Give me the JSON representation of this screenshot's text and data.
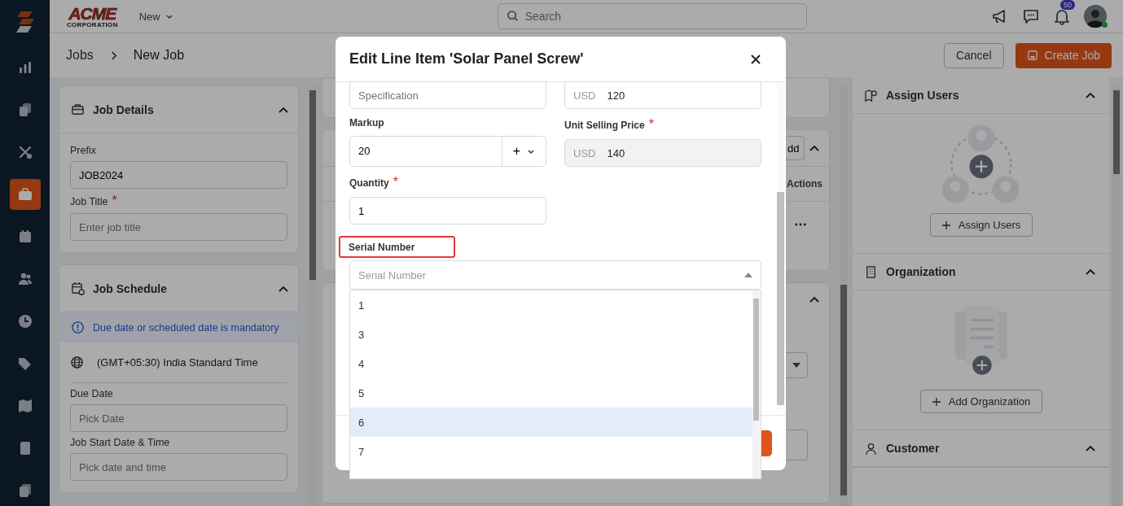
{
  "sidebar": {
    "items": [
      {
        "selected": false
      },
      {
        "selected": false
      },
      {
        "selected": false
      },
      {
        "selected": true
      },
      {
        "selected": false
      },
      {
        "selected": false
      },
      {
        "selected": false
      },
      {
        "selected": false
      },
      {
        "selected": false
      },
      {
        "selected": false
      },
      {
        "selected": false
      }
    ]
  },
  "topbar": {
    "brand": "ACME",
    "brand_sub": "CORPORATION",
    "new_menu": "New",
    "search": {
      "placeholder": "Search"
    },
    "notifications": "50",
    "user_online": true
  },
  "header": {
    "breadcrumb": [
      "Jobs",
      "New Job"
    ],
    "cancel": "Cancel",
    "create": "Create Job"
  },
  "job_details": {
    "title": "Job Details",
    "expanded": true,
    "fields": [
      {
        "label": "Prefix",
        "value": "JOB2024"
      },
      {
        "label": "Job Title",
        "required_mark": "*",
        "placeholder": "Enter job title"
      }
    ]
  },
  "job_schedule": {
    "title": "Job Schedule",
    "expanded": true,
    "notice": "Due date or scheduled date is mandatory",
    "timezone": "(GMT+05:30) India Standard Time",
    "fields": [
      {
        "label": "Due Date",
        "placeholder": "Pick Date"
      },
      {
        "label": "Job Start Date & Time",
        "placeholder": "Pick date and time"
      }
    ]
  },
  "line_items": {
    "add_button": "dd",
    "expanded": true,
    "actions_column": "Actions"
  },
  "right_panel": {
    "sections": [
      {
        "kind": "users",
        "title": "Assign Users",
        "expanded": true,
        "button": "Assign Users"
      },
      {
        "kind": "organization",
        "title": "Organization",
        "expanded": true,
        "button": "Add Organization"
      },
      {
        "kind": "customer",
        "title": "Customer",
        "expanded": true
      }
    ]
  },
  "modal": {
    "title": "Edit Line Item 'Solar Panel Screw'",
    "fields": [
      {
        "kind": "text",
        "placeholder": "Specification"
      },
      {
        "kind": "currency",
        "currency": "USD",
        "value": "120",
        "disabled": false
      },
      {
        "kind": "markup",
        "label": "Markup",
        "value": "20",
        "operator": "+"
      },
      {
        "kind": "currency",
        "label": "Unit Selling Price",
        "required_mark": "*",
        "currency": "USD",
        "value": "140",
        "disabled": true
      },
      {
        "kind": "text",
        "label": "Quantity",
        "required_mark": "*",
        "value": "1"
      }
    ],
    "serial": {
      "label": "Serial Number",
      "label_highlighted": true,
      "placeholder": "Serial Number",
      "expanded": true,
      "options": [
        {
          "label": "1",
          "highlighted": false
        },
        {
          "label": "3",
          "highlighted": false
        },
        {
          "label": "4",
          "highlighted": false
        },
        {
          "label": "5",
          "highlighted": false
        },
        {
          "label": "6",
          "highlighted": true
        },
        {
          "label": "7",
          "highlighted": false
        }
      ]
    }
  }
}
